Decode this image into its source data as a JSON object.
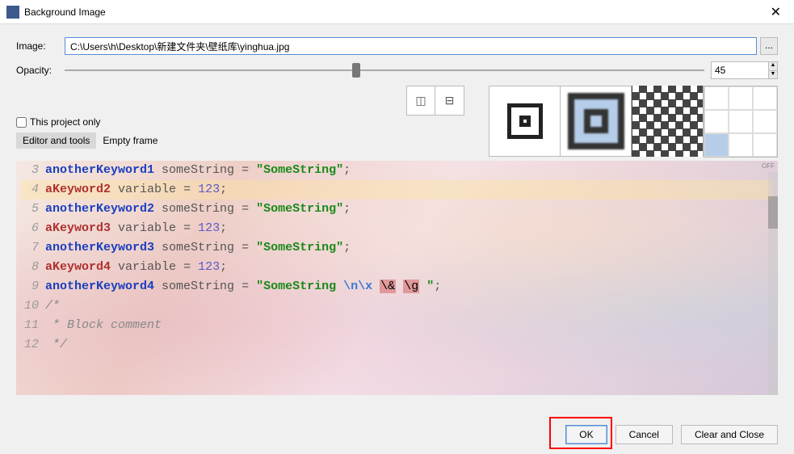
{
  "window": {
    "title": "Background Image",
    "close_glyph": "✕"
  },
  "form": {
    "image_label": "Image:",
    "image_path": "C:\\Users\\h\\Desktop\\新建文件夹\\壁纸库\\yinghua.jpg",
    "browse_glyph": "...",
    "opacity_label": "Opacity:",
    "opacity_value": "45",
    "project_only_label": "This project only",
    "tabs": [
      {
        "label": "Editor and tools",
        "active": true
      },
      {
        "label": "Empty frame",
        "active": false
      }
    ]
  },
  "off_label": "OFF",
  "code": {
    "lines": [
      {
        "n": "3",
        "tokens": [
          [
            "kw1",
            "anotherKeyword1"
          ],
          [
            "sp",
            " "
          ],
          [
            "var",
            "someString"
          ],
          [
            "sp",
            " "
          ],
          [
            "eq",
            "="
          ],
          [
            "sp",
            " "
          ],
          [
            "str",
            "\"SomeString\""
          ],
          [
            "semi",
            ";"
          ]
        ]
      },
      {
        "n": "4",
        "hl": true,
        "tokens": [
          [
            "kw2",
            "aKeyword2"
          ],
          [
            "sp",
            " "
          ],
          [
            "var",
            "variable"
          ],
          [
            "sp",
            " "
          ],
          [
            "eq",
            "="
          ],
          [
            "sp",
            " "
          ],
          [
            "num",
            "123"
          ],
          [
            "semi",
            ";"
          ]
        ]
      },
      {
        "n": "5",
        "tokens": [
          [
            "kw1",
            "anotherKeyword2"
          ],
          [
            "sp",
            " "
          ],
          [
            "var",
            "someString"
          ],
          [
            "sp",
            " "
          ],
          [
            "eq",
            "="
          ],
          [
            "sp",
            " "
          ],
          [
            "str",
            "\"SomeString\""
          ],
          [
            "semi",
            ";"
          ]
        ]
      },
      {
        "n": "6",
        "tokens": [
          [
            "kw2",
            "aKeyword3"
          ],
          [
            "sp",
            " "
          ],
          [
            "var",
            "variable"
          ],
          [
            "sp",
            " "
          ],
          [
            "eq",
            "="
          ],
          [
            "sp",
            " "
          ],
          [
            "num",
            "123"
          ],
          [
            "semi",
            ";"
          ]
        ]
      },
      {
        "n": "7",
        "tokens": [
          [
            "kw1",
            "anotherKeyword3"
          ],
          [
            "sp",
            " "
          ],
          [
            "var",
            "someString"
          ],
          [
            "sp",
            " "
          ],
          [
            "eq",
            "="
          ],
          [
            "sp",
            " "
          ],
          [
            "str",
            "\"SomeString\""
          ],
          [
            "semi",
            ";"
          ]
        ]
      },
      {
        "n": "8",
        "tokens": [
          [
            "kw2",
            "aKeyword4"
          ],
          [
            "sp",
            " "
          ],
          [
            "var",
            "variable"
          ],
          [
            "sp",
            " "
          ],
          [
            "eq",
            "="
          ],
          [
            "sp",
            " "
          ],
          [
            "num",
            "123"
          ],
          [
            "semi",
            ";"
          ]
        ]
      },
      {
        "n": "9",
        "tokens": [
          [
            "kw1",
            "anotherKeyword4"
          ],
          [
            "sp",
            " "
          ],
          [
            "var",
            "someString"
          ],
          [
            "sp",
            " "
          ],
          [
            "eq",
            "="
          ],
          [
            "sp",
            " "
          ],
          [
            "str",
            "\"SomeString "
          ],
          [
            "esc",
            "\\n\\x"
          ],
          [
            "sp",
            "  "
          ],
          [
            "inv",
            "\\&"
          ],
          [
            "sp",
            " "
          ],
          [
            "inv",
            "\\g"
          ],
          [
            "sp",
            " "
          ],
          [
            "str",
            "\""
          ],
          [
            "semi",
            ";"
          ]
        ]
      },
      {
        "n": "10",
        "tokens": [
          [
            "cmt",
            "/*"
          ]
        ]
      },
      {
        "n": "11",
        "tokens": [
          [
            "cmt",
            " * Block comment"
          ]
        ]
      },
      {
        "n": "12",
        "tokens": [
          [
            "cmt",
            " */"
          ]
        ]
      }
    ]
  },
  "buttons": {
    "ok": "OK",
    "cancel": "Cancel",
    "clear": "Clear and Close"
  }
}
